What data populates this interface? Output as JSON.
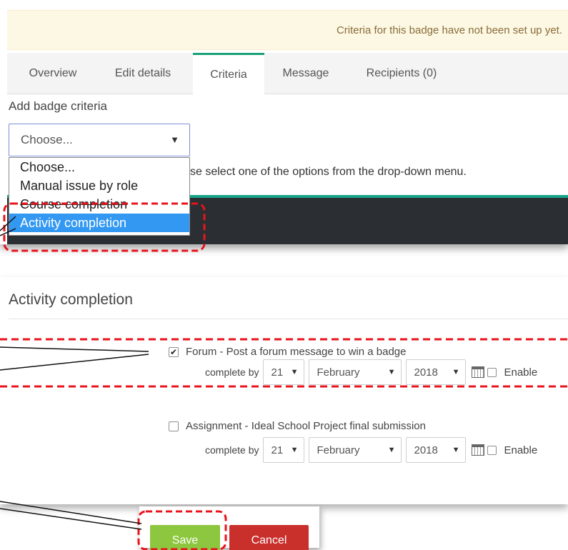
{
  "notice": {
    "text": "Criteria for this badge have not been set up yet."
  },
  "tabs": [
    {
      "label": "Overview"
    },
    {
      "label": "Edit details"
    },
    {
      "label": "Criteria"
    },
    {
      "label": "Message"
    },
    {
      "label": "Recipients (0)"
    }
  ],
  "criteria": {
    "label": "Add badge criteria",
    "select_value": "Choose...",
    "help_text": "se select one of the options from the drop-down menu.",
    "options": [
      "Choose...",
      "Manual issue by role",
      "Course completion",
      "Activity completion"
    ],
    "selected_option": "Activity completion"
  },
  "activity": {
    "title": "Activity completion",
    "items": [
      {
        "label": "Forum - Post a forum message to win a badge",
        "checked": true,
        "complete_by": "complete by",
        "day": "21",
        "month": "February",
        "year": "2018",
        "enable_label": "Enable"
      },
      {
        "label": "Assignment - Ideal School Project final submission",
        "checked": false,
        "complete_by": "complete by",
        "day": "21",
        "month": "February",
        "year": "2018",
        "enable_label": "Enable"
      }
    ]
  },
  "buttons": {
    "save": "Save",
    "cancel": "Cancel"
  },
  "colors": {
    "accent_green": "#17a589",
    "save": "#8dc63f",
    "cancel": "#c9302c",
    "selected_option": "#3398f2",
    "highlight_dash": "#e8141c"
  },
  "icons": [
    "checkmark-icon",
    "dropdown-arrow-icon",
    "calendar-icon"
  ]
}
